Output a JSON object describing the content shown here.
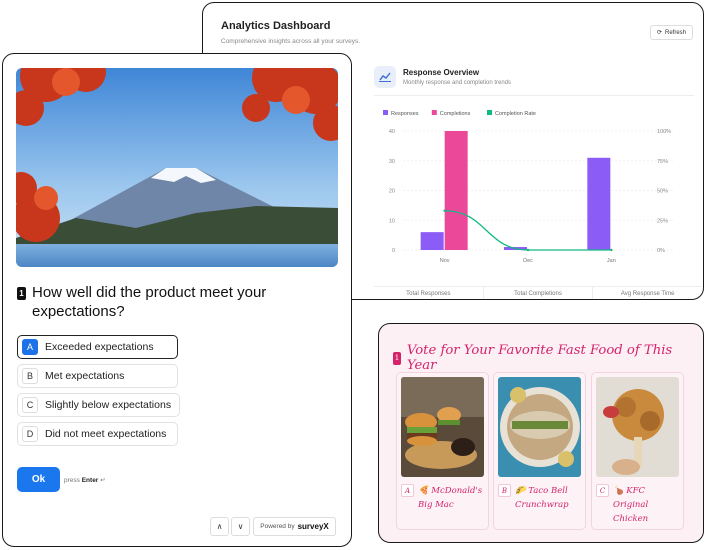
{
  "analytics": {
    "title": "Analytics Dashboard",
    "subtitle": "Comprehensive insights across all your surveys.",
    "refresh_label": "Refresh",
    "overview_title": "Response Overview",
    "overview_subtitle": "Monthly response and completion trends",
    "stats": [
      "Total Responses",
      "Total Completions",
      "Avg Response Time"
    ]
  },
  "chart_data": {
    "type": "bar",
    "categories": [
      "Nov",
      "Dec",
      "Jan"
    ],
    "series": [
      {
        "name": "Responses",
        "kind": "bar",
        "color": "#8b5cf6",
        "axis": "left",
        "values": [
          6,
          1,
          31
        ]
      },
      {
        "name": "Completions",
        "kind": "bar",
        "color": "#ec4899",
        "axis": "left",
        "values": [
          40,
          0,
          0
        ]
      },
      {
        "name": "Completion Rate",
        "kind": "line",
        "color": "#10b981",
        "axis": "right",
        "values": [
          33,
          0,
          0
        ]
      }
    ],
    "ylim": [
      0,
      40
    ],
    "y_ticks": [
      "0",
      "10",
      "20",
      "30",
      "40"
    ],
    "y2lim": [
      0,
      100
    ],
    "y2_ticks": [
      "0%",
      "25%",
      "50%",
      "75%",
      "100%"
    ],
    "legend": "top-left",
    "grid": true
  },
  "survey": {
    "question_number": "1",
    "question": "How well did the product meet your expectations?",
    "options": [
      {
        "key": "A",
        "label": "Exceeded expectations",
        "selected": true
      },
      {
        "key": "B",
        "label": "Met expectations",
        "selected": false
      },
      {
        "key": "C",
        "label": "Slightly below expectations",
        "selected": false
      },
      {
        "key": "D",
        "label": "Did not meet expectations",
        "selected": false
      }
    ],
    "ok_label": "Ok",
    "press_label": "press",
    "press_key": "Enter",
    "press_icon": "↵",
    "nav_up": "∧",
    "nav_down": "∨",
    "powered_by": "Powered by",
    "brand": "surveyX"
  },
  "vote": {
    "question_number": "1",
    "title": "Vote for Your Favorite Fast Food of This Year",
    "items": [
      {
        "key": "A",
        "emoji": "🍕",
        "label": "McDonald's Big Mac"
      },
      {
        "key": "B",
        "emoji": "🌮",
        "label": "Taco Bell Crunchwrap"
      },
      {
        "key": "C",
        "emoji": "🍗",
        "label": "KFC Original Chicken"
      }
    ]
  }
}
